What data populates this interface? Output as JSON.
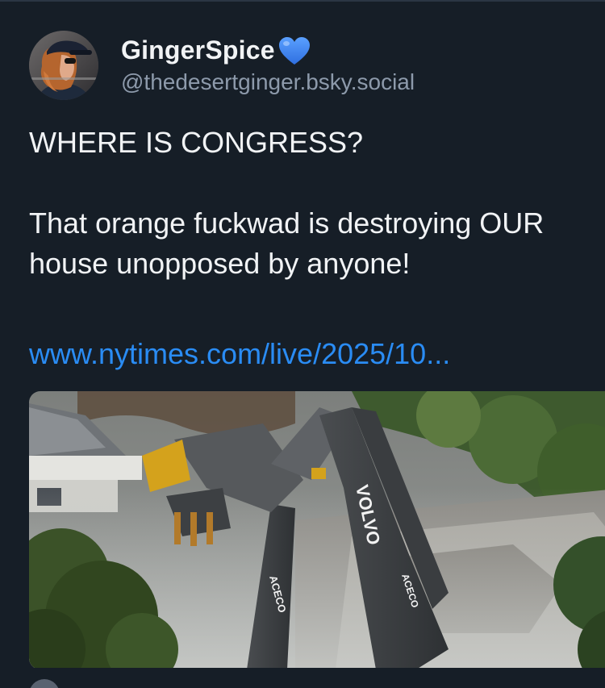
{
  "post": {
    "display_name": "GingerSpice",
    "display_name_badge": "blue-heart-icon",
    "handle": "@thedesertginger.bsky.social",
    "text_line_1": "WHERE IS CONGRESS?",
    "text_line_2": "That orange fuckwad is destroying OUR house unopposed by anyone!",
    "link": "www.nytimes.com/live/2025/10..."
  },
  "embed_image": {
    "excavator_brand_1": "VOLVO",
    "excavator_model_1": "ACECO",
    "excavator_model_2": "ACECO"
  },
  "colors": {
    "background": "#161e27",
    "text": "#f1f3f5",
    "handle": "#8d9aab",
    "link": "#2a8cf4",
    "heart": "#3b82f6"
  }
}
